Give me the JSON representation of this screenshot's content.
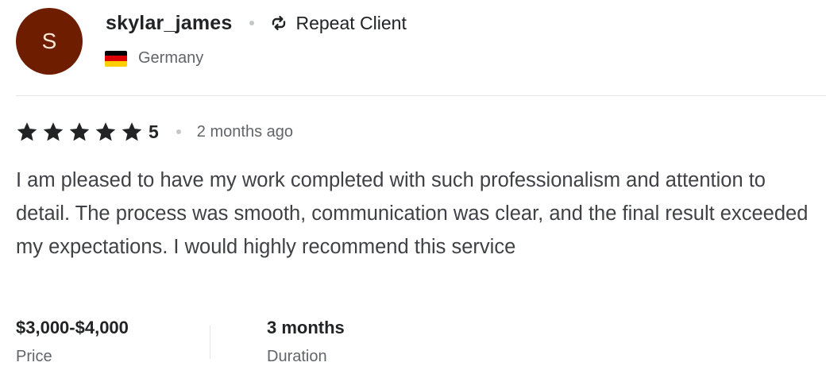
{
  "reviewer": {
    "avatar_initial": "S",
    "avatar_color": "#6f1d00",
    "username": "skylar_james",
    "badge_icon": "repeat-icon",
    "badge_label": "Repeat Client",
    "country": "Germany",
    "country_flag": "flag-germany-icon"
  },
  "rating": {
    "stars": 5,
    "value": "5",
    "time_ago": "2 months ago"
  },
  "review_text": "I am pleased to have my work completed with such professionalism and attention to detail. The process was smooth, communication was clear, and the final result exceeded my expectations. I would highly recommend this service",
  "stats": {
    "price_value": "$3,000-$4,000",
    "price_label": "Price",
    "duration_value": "3 months",
    "duration_label": "Duration"
  }
}
